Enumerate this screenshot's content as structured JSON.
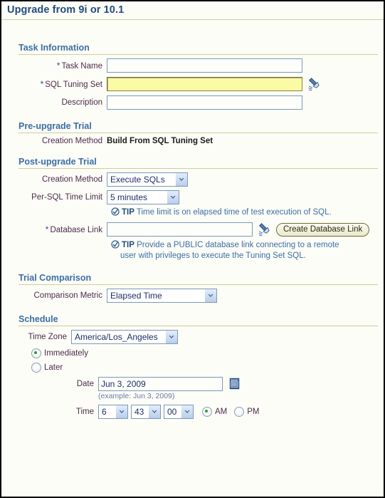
{
  "page": {
    "title": "Upgrade from 9i or 10.1"
  },
  "sections": {
    "task_information": {
      "heading": "Task Information",
      "task_name": {
        "label": "Task Name",
        "required_marker": "*",
        "value": "",
        "placeholder": ""
      },
      "sql_tuning_set": {
        "label": "SQL Tuning Set",
        "required_marker": "*",
        "value": "",
        "placeholder": "",
        "search_icon": "flashlight-search-icon"
      },
      "description": {
        "label": "Description",
        "value": "",
        "placeholder": ""
      }
    },
    "pre_upgrade_trial": {
      "heading": "Pre-upgrade Trial",
      "creation_method": {
        "label": "Creation Method",
        "value": "Build From SQL Tuning Set"
      }
    },
    "post_upgrade_trial": {
      "heading": "Post-upgrade Trial",
      "creation_method": {
        "label": "Creation Method",
        "selected": "Execute SQLs",
        "options": [
          "Execute SQLs"
        ]
      },
      "per_sql_time_limit": {
        "label": "Per-SQL Time Limit",
        "selected": "5 minutes",
        "options": [
          "5 minutes"
        ]
      },
      "time_limit_tip": {
        "icon": "tip-check-icon",
        "word": "TIP",
        "text": "Time limit is on elapsed time of test execution of SQL."
      },
      "database_link": {
        "label": "Database Link",
        "required_marker": "*",
        "value": "",
        "placeholder": "",
        "search_icon": "flashlight-search-icon",
        "button_label": "Create Database Link"
      },
      "database_link_tip": {
        "icon": "tip-check-icon",
        "word": "TIP",
        "text_line1": "Provide a PUBLIC database link connecting to a remote",
        "text_line2": "user with privileges to execute the Tuning Set SQL."
      }
    },
    "trial_comparison": {
      "heading": "Trial Comparison",
      "comparison_metric": {
        "label": "Comparison Metric",
        "selected": "Elapsed Time",
        "options": [
          "Elapsed Time"
        ]
      }
    },
    "schedule": {
      "heading": "Schedule",
      "time_zone": {
        "label": "Time Zone",
        "selected": "America/Los_Angeles",
        "options": [
          "America/Los_Angeles"
        ]
      },
      "immediately": {
        "label": "Immediately",
        "selected": true
      },
      "later": {
        "label": "Later",
        "selected": false
      },
      "date": {
        "label": "Date",
        "value": "Jun 3, 2009",
        "hint": "(example: Jun 3, 2009)",
        "calendar_icon": "calendar-icon"
      },
      "time": {
        "label": "Time",
        "hour": "6",
        "minute": "43",
        "second": "00",
        "am_label": "AM",
        "pm_label": "PM",
        "am_selected": true,
        "pm_selected": false
      }
    }
  },
  "colors": {
    "title_blue": "#1f4b7e",
    "section_blue": "#3b6ea5",
    "rule_khaki": "#cdcd9a",
    "label_plum": "#4c2a4c",
    "required_star": "#2a4f8f",
    "focus_yellow": "#fbfaa5",
    "radio_green": "#2f9c2f",
    "page_bg": "#fdfdf7"
  }
}
